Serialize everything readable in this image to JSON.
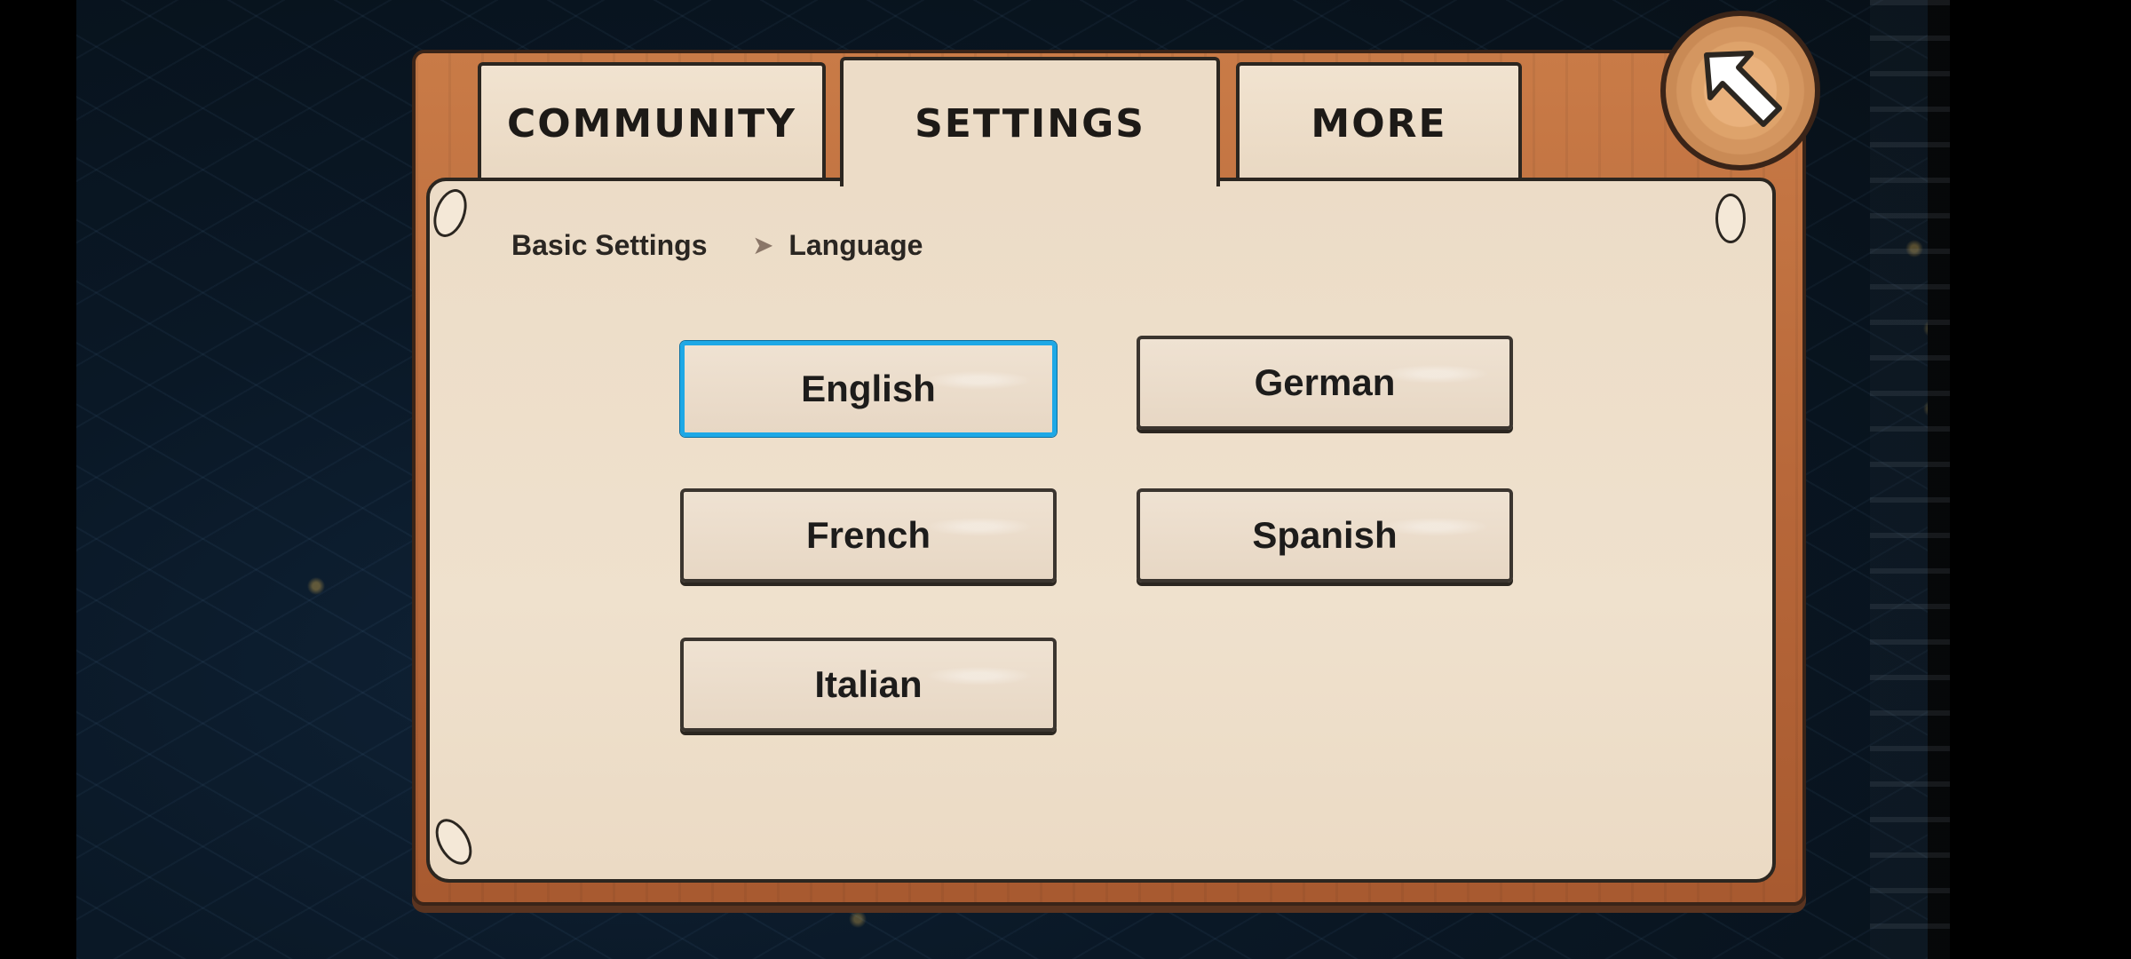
{
  "tabs": [
    {
      "label": "COMMUNITY",
      "active": false
    },
    {
      "label": "SETTINGS",
      "active": true
    },
    {
      "label": "MORE",
      "active": false
    }
  ],
  "breadcrumb": {
    "parent": "Basic Settings",
    "separator_icon": "chevron-right-icon",
    "current": "Language"
  },
  "languages": [
    {
      "label": "English",
      "selected": true
    },
    {
      "label": "German",
      "selected": false
    },
    {
      "label": "French",
      "selected": false
    },
    {
      "label": "Spanish",
      "selected": false
    },
    {
      "label": "Italian",
      "selected": false
    }
  ],
  "back_button": {
    "icon": "back-arrow-icon"
  },
  "colors": {
    "wood": "#b8683a",
    "paper": "#ecdcc7",
    "selected_outline": "#1ea8e6",
    "text": "#1d1a17"
  }
}
